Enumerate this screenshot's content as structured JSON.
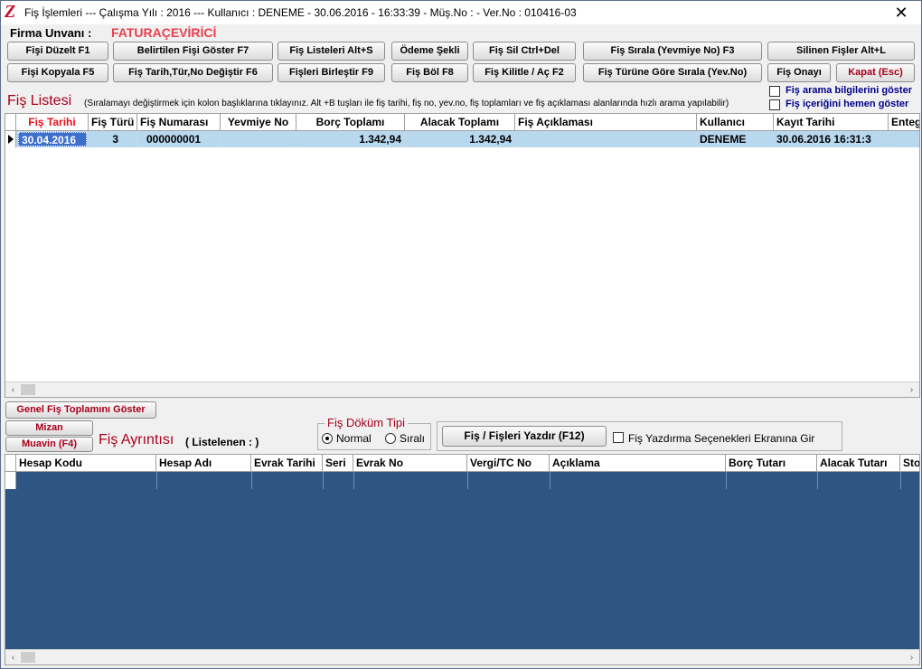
{
  "window": {
    "app_logo": "Z",
    "title": "Fiş İşlemleri  ---  Çalışma Yılı : 2016  ---  Kullanıcı : DENEME - 30.06.2016 - 16:33:39 - Müş.No :  - Ver.No : 010416-03",
    "close": "✕"
  },
  "firma": {
    "label": "Firma  Unvanı :",
    "value": "FATURAÇEVİRİCİ"
  },
  "toolbar": {
    "row1": [
      "Fişi Düzelt F1",
      "Belirtilen Fişi Göster F7",
      "Fiş Listeleri Alt+S",
      "Ödeme Şekli",
      "Fiş Sil Ctrl+Del",
      "Fiş Sırala (Yevmiye No) F3",
      "Silinen Fişler Alt+L"
    ],
    "row2": [
      "Fişi Kopyala F5",
      "Fiş Tarih,Tür,No Değiştir F6",
      "Fişleri Birleştir F9",
      "Fiş Böl F8",
      "Fiş Kilitle / Aç F2",
      "Fiş Türüne Göre Sırala (Yev.No)",
      "Fiş Onayı",
      "Kapat (Esc)"
    ]
  },
  "fis_listesi": {
    "title": "Fiş Listesi",
    "hint": "(Sıralamayı değiştirmek için kolon başlıklarına tıklayınız. Alt +B tuşları ile fiş tarihi, fiş no, yev.no, fiş toplamları ve fiş açıklaması alanlarında hızlı arama yapılabilir)",
    "options": [
      "Fiş arama bilgilerini göster",
      "Fiş içeriğini hemen göster"
    ],
    "columns": [
      "Fiş Tarihi",
      "Fiş Türü",
      "Fiş Numarası",
      "Yevmiye No",
      "Borç Toplamı",
      "Alacak Toplamı",
      "Fiş Açıklaması",
      "Kullanıcı",
      "Kayıt Tarihi",
      "Enteg"
    ],
    "rows": [
      [
        "30.04.2016",
        "3",
        "000000001",
        "",
        "1.342,94",
        "1.342,94",
        "",
        "DENEME",
        "30.06.2016 16:31:3",
        ""
      ]
    ]
  },
  "genel_toplam_button": "Genel Fiş Toplamını Göster",
  "mizan_button": "Mizan",
  "muavin_button": "Muavin (F4)",
  "fis_ayrintisi": {
    "title": "Fiş Ayrıntısı",
    "subtitle": "( Listelenen : )"
  },
  "dokum_tipi": {
    "title": "Fiş Döküm Tipi",
    "options": [
      "Normal",
      "Sıralı"
    ],
    "selected": "Normal"
  },
  "print_button": "Fiş / Fişleri Yazdır (F12)",
  "print_options_label": "Fiş Yazdırma Seçenekleri Ekranına Gir",
  "detail_grid": {
    "columns": [
      "Hesap Kodu",
      "Hesap Adı",
      "Evrak Tarihi",
      "Seri",
      "Evrak No",
      "Vergi/TC No",
      "Açıklama",
      "Borç Tutarı",
      "Alacak Tutarı",
      "Stok"
    ]
  },
  "scroll": {
    "left": "‹",
    "right": "›",
    "up": "˄",
    "down": "˅"
  },
  "colors": {
    "accent_red": "#c8102e",
    "row_selected": "#b8d8f0",
    "grid_body_dark": "#2e5584",
    "hint_blue": "#00008b"
  }
}
